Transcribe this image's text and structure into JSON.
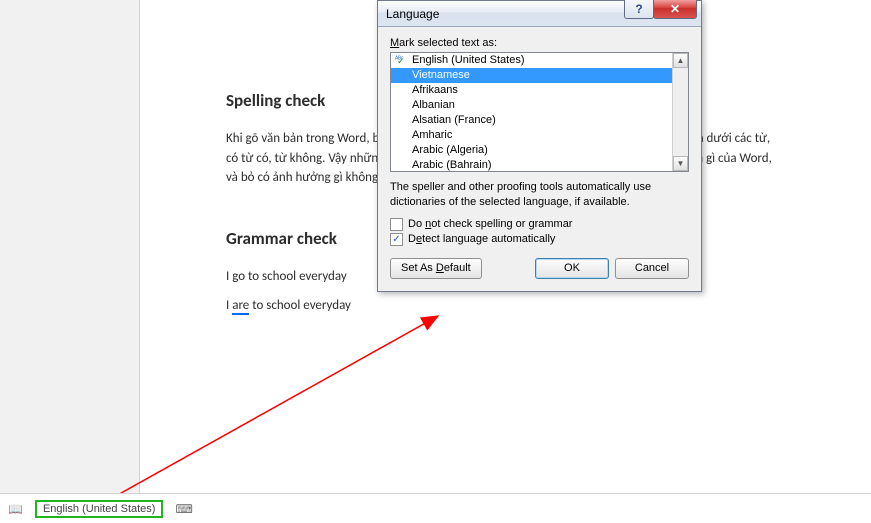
{
  "document": {
    "heading1": "Spelling check",
    "para1": "Khi gõ văn bản trong Word, bạn thường thấy xuất hiện các đường gạch chân màu đỏ ở bên dưới các từ, có từ có, từ không. Vậy những gạch chân màu đỏ và màu xanh xuất hiện bên dưới các từ là gì của Word, và bỏ có ảnh hưởng gì không? Hãy đọc bài viết sau.",
    "heading2": "Grammar check",
    "para2_pre": "I go to school everyday",
    "para3_pre": "I ",
    "para3_err": "are",
    "para3_post": " to school everyday"
  },
  "statusbar": {
    "book_icon": "📖",
    "language_label": "English (United States)",
    "macro_icon": "⌨"
  },
  "dialog": {
    "title": "Language",
    "mark_label_pre": "",
    "mark_label_m": "M",
    "mark_label_rest": "ark selected text as:",
    "items": [
      {
        "label": "English (United States)",
        "has_spell": true,
        "selected": false
      },
      {
        "label": "Vietnamese",
        "has_spell": false,
        "selected": true
      },
      {
        "label": "Afrikaans",
        "has_spell": false,
        "selected": false
      },
      {
        "label": "Albanian",
        "has_spell": false,
        "selected": false
      },
      {
        "label": "Alsatian (France)",
        "has_spell": false,
        "selected": false
      },
      {
        "label": "Amharic",
        "has_spell": false,
        "selected": false
      },
      {
        "label": "Arabic (Algeria)",
        "has_spell": false,
        "selected": false
      },
      {
        "label": "Arabic (Bahrain)",
        "has_spell": false,
        "selected": false
      }
    ],
    "hint_text": "The speller and other proofing tools automatically use dictionaries of the selected language, if available.",
    "chk1_pre": "Do ",
    "chk1_u": "n",
    "chk1_post": "ot check spelling or grammar",
    "chk1_checked": false,
    "chk2_pre": "D",
    "chk2_u": "e",
    "chk2_post": "tect language automatically",
    "chk2_checked": true,
    "btn_default_pre": "Set As ",
    "btn_default_u": "D",
    "btn_default_post": "efault",
    "btn_ok": "OK",
    "btn_cancel": "Cancel"
  }
}
